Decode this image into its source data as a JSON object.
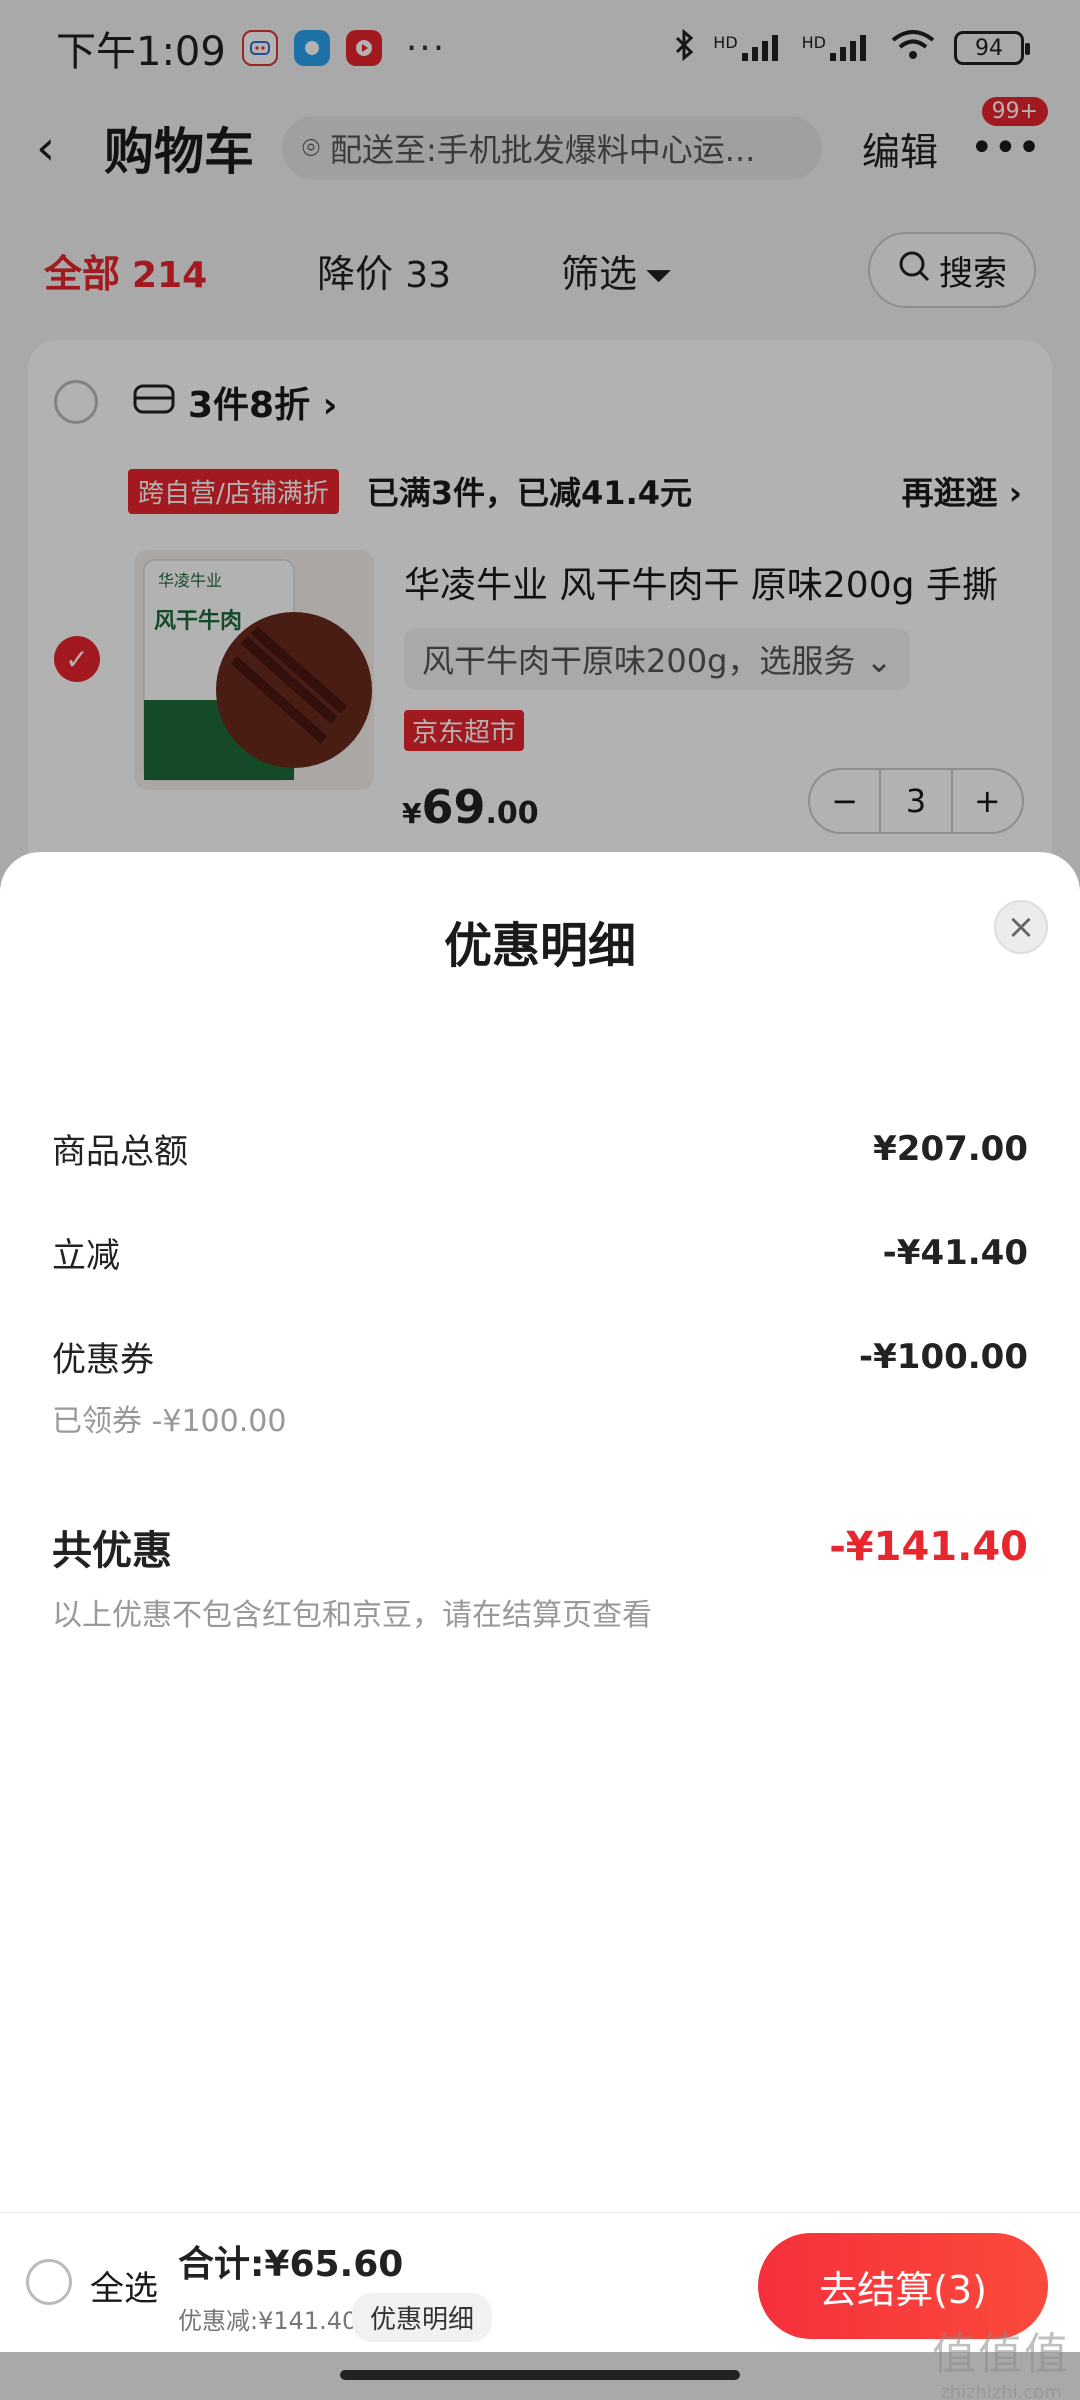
{
  "status_bar": {
    "time": "下午1:09",
    "more": "···",
    "signal_1": "HD",
    "signal_2": "HD",
    "battery": "94"
  },
  "header": {
    "back": "‹",
    "title": "购物车",
    "address": "配送至:手机批发爆料中心运...",
    "edit": "编辑",
    "more": "•••",
    "badge": "99+"
  },
  "tabs": {
    "all_label": "全部",
    "all_count": "214",
    "price_drop_label": "降价",
    "price_drop_count": "33",
    "filter_label": "筛选",
    "search_label": "搜索"
  },
  "cart": {
    "promo_title": "3件8折 ›",
    "promo_tag": "跨自营/店铺满折",
    "promo_text": "已满3件，已减41.4元",
    "more_link": "再逛逛 ›",
    "item": {
      "name": "华凌牛业 风干牛肉干 原味200g 手撕",
      "spec": "风干牛肉干原味200g，选服务 ⌄",
      "store_tag": "京东超市",
      "price_symbol": "¥",
      "price_int": "69",
      "price_dec": ".00",
      "qty": "3",
      "minus": "−",
      "plus": "+",
      "thumb_brand": "华凌牛业",
      "thumb_name": "风干牛肉"
    }
  },
  "sheet": {
    "title": "优惠明细",
    "close": "×",
    "rows": [
      {
        "label": "商品总额",
        "value": "¥207.00"
      },
      {
        "label": "立减",
        "value": "-¥41.40"
      },
      {
        "label": "优惠券",
        "value": "-¥100.00",
        "sub": "已领券 -¥100.00"
      }
    ],
    "total": {
      "label": "共优惠",
      "value": "-¥141.40",
      "note": "以上优惠不包含红包和京豆，请在结算页查看"
    }
  },
  "bottom_bar": {
    "select_all": "全选",
    "total": "合计:¥65.60",
    "discount": "优惠减:¥141.40",
    "detail_btn": "优惠明细",
    "checkout": "去结算(3)"
  },
  "watermark": {
    "line1": "值值值",
    "line2": "zhizhizhi.com"
  },
  "colors": {
    "accent": "#e8262d",
    "overlay": "rgba(0,0,0,0.30)"
  }
}
